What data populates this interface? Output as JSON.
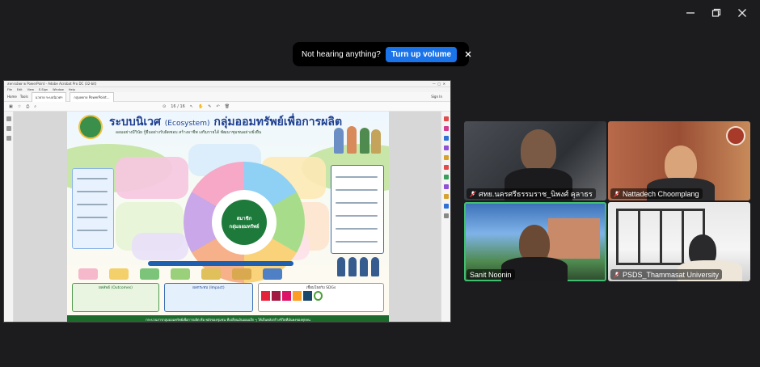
{
  "window": {
    "controls": [
      {
        "name": "minimize-button",
        "icon": "minimize-icon"
      },
      {
        "name": "restore-button",
        "icon": "restore-icon"
      },
      {
        "name": "close-button",
        "icon": "close-icon"
      }
    ]
  },
  "notice": {
    "message": "Not hearing anything?",
    "action_label": "Turn up volume",
    "close_icon": "close-icon",
    "action_color": "#1a73e8"
  },
  "shared_screen": {
    "titlebar": "สหกรณ์พยาย PowerPoint - Adobe Acrobat Pro DC (32-bit)",
    "menu": [
      "File",
      "Edit",
      "View",
      "E-Sign",
      "Window",
      "Help"
    ],
    "tabs": [
      "Home",
      "Tools",
      "นวยาย ระบบนิเวศฯ",
      "กลุ่มพยาย PowerPoint..."
    ],
    "sign_in": "Sign In",
    "page_indicator": "16 / 16",
    "poster": {
      "title_thai": "ระบบนิเวศ",
      "title_en": "(Ecosystem)",
      "title_rest": "กลุ่มออมทรัพย์เพื่อการผลิต",
      "subtitle": "ออมอย่างมีวินัย กู้ยืมอย่างรับผิดชอบ สร้างอาชีพ เสริมรายได้ พัฒนาชุมชนอย่างยั่งยืน",
      "core_line1": "สมาชิก",
      "core_line2": "กลุ่มออมทรัพย์",
      "outcomes_label": "ผลลัพธ์ (Outcomes)",
      "impact_label": "ผลกระทบ (Impact)",
      "sdg_label": "เชื่อมโยงกับ SDGs",
      "footer": "กระบวนการกลุ่มออมทรัพย์เพื่อการผลิต คือ พลังของชุมชน ที่เปลี่ยนเงินออมเล็ก ๆ ให้เป็นพลังสร้างชีวิตที่มั่นคงของทุกคน"
    }
  },
  "participants": [
    {
      "name": "ศทย.นครศรีธรรมราช_นิพงศ์ คุลาธร",
      "muted": true,
      "speaking": false
    },
    {
      "name": "Nattadech Choomplang",
      "muted": true,
      "speaking": false
    },
    {
      "name": "Sanit Noonin",
      "muted": false,
      "speaking": true
    },
    {
      "name": "PSDS_Thammasat University",
      "muted": true,
      "speaking": false
    }
  ]
}
